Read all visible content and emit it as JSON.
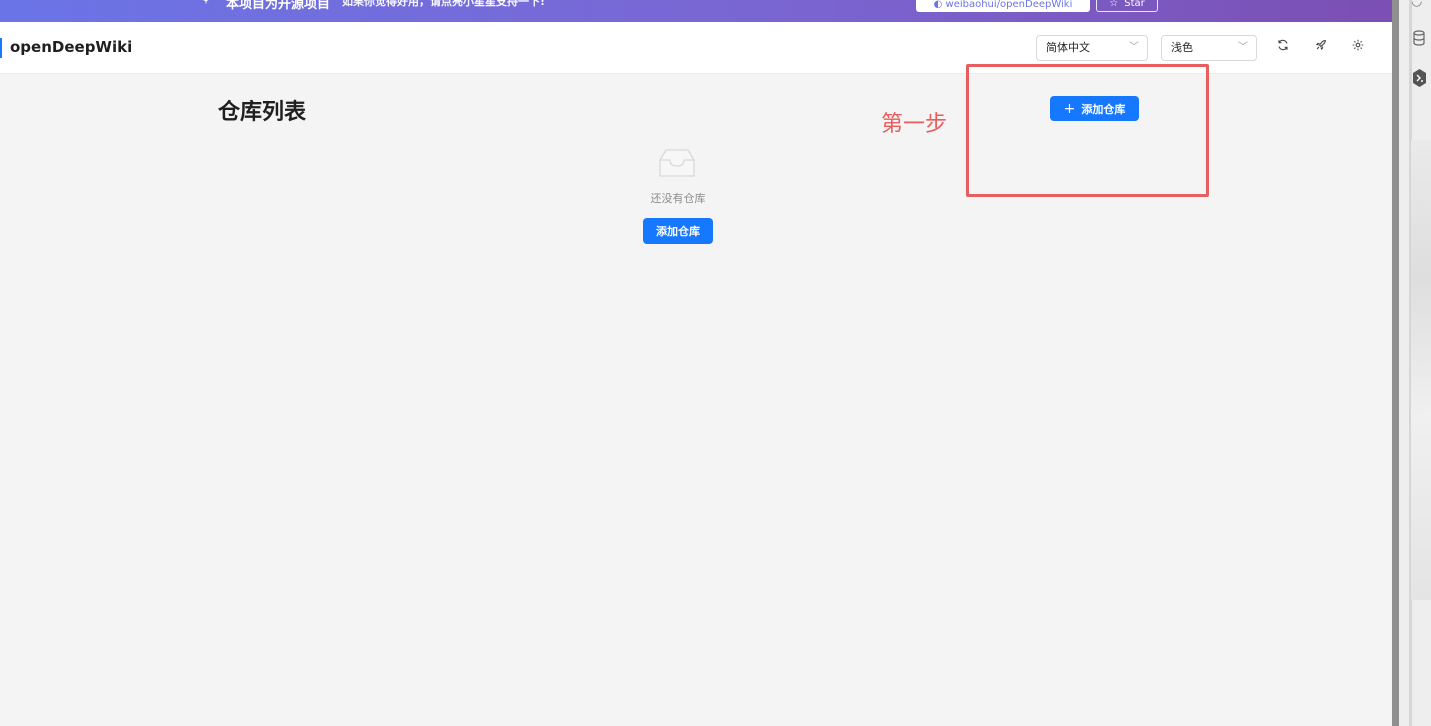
{
  "banner": {
    "title": "本项目为开源项目",
    "description": "如果你觉得好用，请点亮小星星支持一下!",
    "github_label": "weibaohui/openDeepWiki",
    "star_label": "Star"
  },
  "header": {
    "logo": "openDeepWiki",
    "language_select": "简体中文",
    "theme_select": "浅色",
    "icons": [
      "refresh-icon",
      "rocket-icon",
      "settings-icon"
    ]
  },
  "main": {
    "page_title": "仓库列表",
    "add_repo_button": "添加仓库",
    "empty_text": "还没有仓库",
    "empty_add_button": "添加仓库"
  },
  "annotation": {
    "text": "第一步",
    "color": "#e85d5d"
  },
  "colors": {
    "primary": "#1677ff",
    "banner_start": "#6b74e6",
    "banner_end": "#7b4fb3",
    "background": "#f4f4f4"
  }
}
